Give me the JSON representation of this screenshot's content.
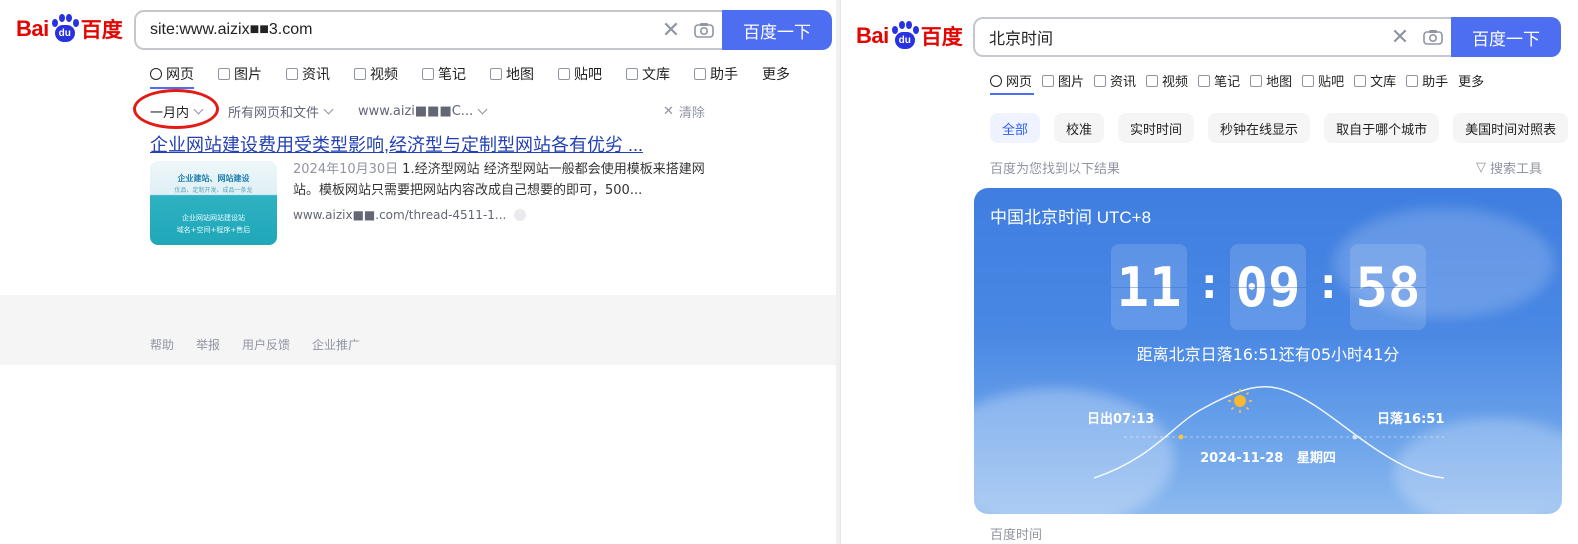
{
  "left": {
    "logo": {
      "bai": "Bai",
      "du": "du",
      "cn": "百度"
    },
    "search": {
      "query": "site:www.aizix■■3.com",
      "button": "百度一下"
    },
    "tabs": [
      {
        "label": "网页",
        "icon": "search-icon"
      },
      {
        "label": "图片",
        "icon": "image-icon"
      },
      {
        "label": "资讯",
        "icon": "news-icon"
      },
      {
        "label": "视频",
        "icon": "video-icon"
      },
      {
        "label": "笔记",
        "icon": "note-icon"
      },
      {
        "label": "地图",
        "icon": "map-icon"
      },
      {
        "label": "贴吧",
        "icon": "tieba-icon"
      },
      {
        "label": "文库",
        "icon": "doc-icon"
      },
      {
        "label": "助手",
        "icon": "ai-icon"
      },
      {
        "label": "更多",
        "icon": ""
      }
    ],
    "filters": {
      "time": "一月内",
      "type": "所有网页和文件",
      "site": "www.aizi■■■C...",
      "clear": "清除"
    },
    "result": {
      "title": "企业网站建设费用受类型影响,经济型与定制型网站各有优劣 ...",
      "thumb": {
        "line1": "企业建站、网站建设",
        "line2": "优品、定制开发、成品一条龙",
        "line3": "企业网站网站建设站",
        "line4": "域名+空间+程序+售后"
      },
      "date": "2024年10月30日",
      "snippet_line1": "1.经济型网站 经济型网站一般都会使用模板来搭建网",
      "snippet_line2": "站。模板网站只需要把网站内容改成自己想要的即可，500...",
      "url": "www.aizix■■.com/thread-4511-1..."
    },
    "footer": [
      "帮助",
      "举报",
      "用户反馈",
      "企业推广"
    ]
  },
  "right": {
    "logo": {
      "bai": "Bai",
      "du": "du",
      "cn": "百度"
    },
    "search": {
      "query": "北京时间",
      "button": "百度一下"
    },
    "tabs": [
      {
        "label": "网页",
        "icon": "search-icon"
      },
      {
        "label": "图片",
        "icon": "image-icon"
      },
      {
        "label": "资讯",
        "icon": "news-icon"
      },
      {
        "label": "视频",
        "icon": "video-icon"
      },
      {
        "label": "笔记",
        "icon": "note-icon"
      },
      {
        "label": "地图",
        "icon": "map-icon"
      },
      {
        "label": "贴吧",
        "icon": "tieba-icon"
      },
      {
        "label": "文库",
        "icon": "doc-icon"
      },
      {
        "label": "助手",
        "icon": "ai-icon"
      },
      {
        "label": "更多",
        "icon": ""
      }
    ],
    "chips": [
      "全部",
      "校准",
      "实时时间",
      "秒钟在线显示",
      "取自于哪个城市",
      "美国时间对照表"
    ],
    "found_text": "百度为您找到以下结果",
    "search_tools": "搜索工具",
    "card": {
      "title": "中国北京时间 UTC+8",
      "hours": "11",
      "minutes": "09",
      "seconds": "58",
      "colon": ":",
      "sunset_text": "距离北京日落16:51还有05小时41分",
      "sunrise": "日出07:13",
      "sunset": "日落16:51",
      "date": "2024-11-28   星期四"
    },
    "source": "百度时间"
  },
  "colors": {
    "brand_blue": "#4e6ef2",
    "logo_red": "#e10601",
    "logo_blue": "#2932e1",
    "link_blue": "#2440b3",
    "oval_red": "#e41a13"
  }
}
